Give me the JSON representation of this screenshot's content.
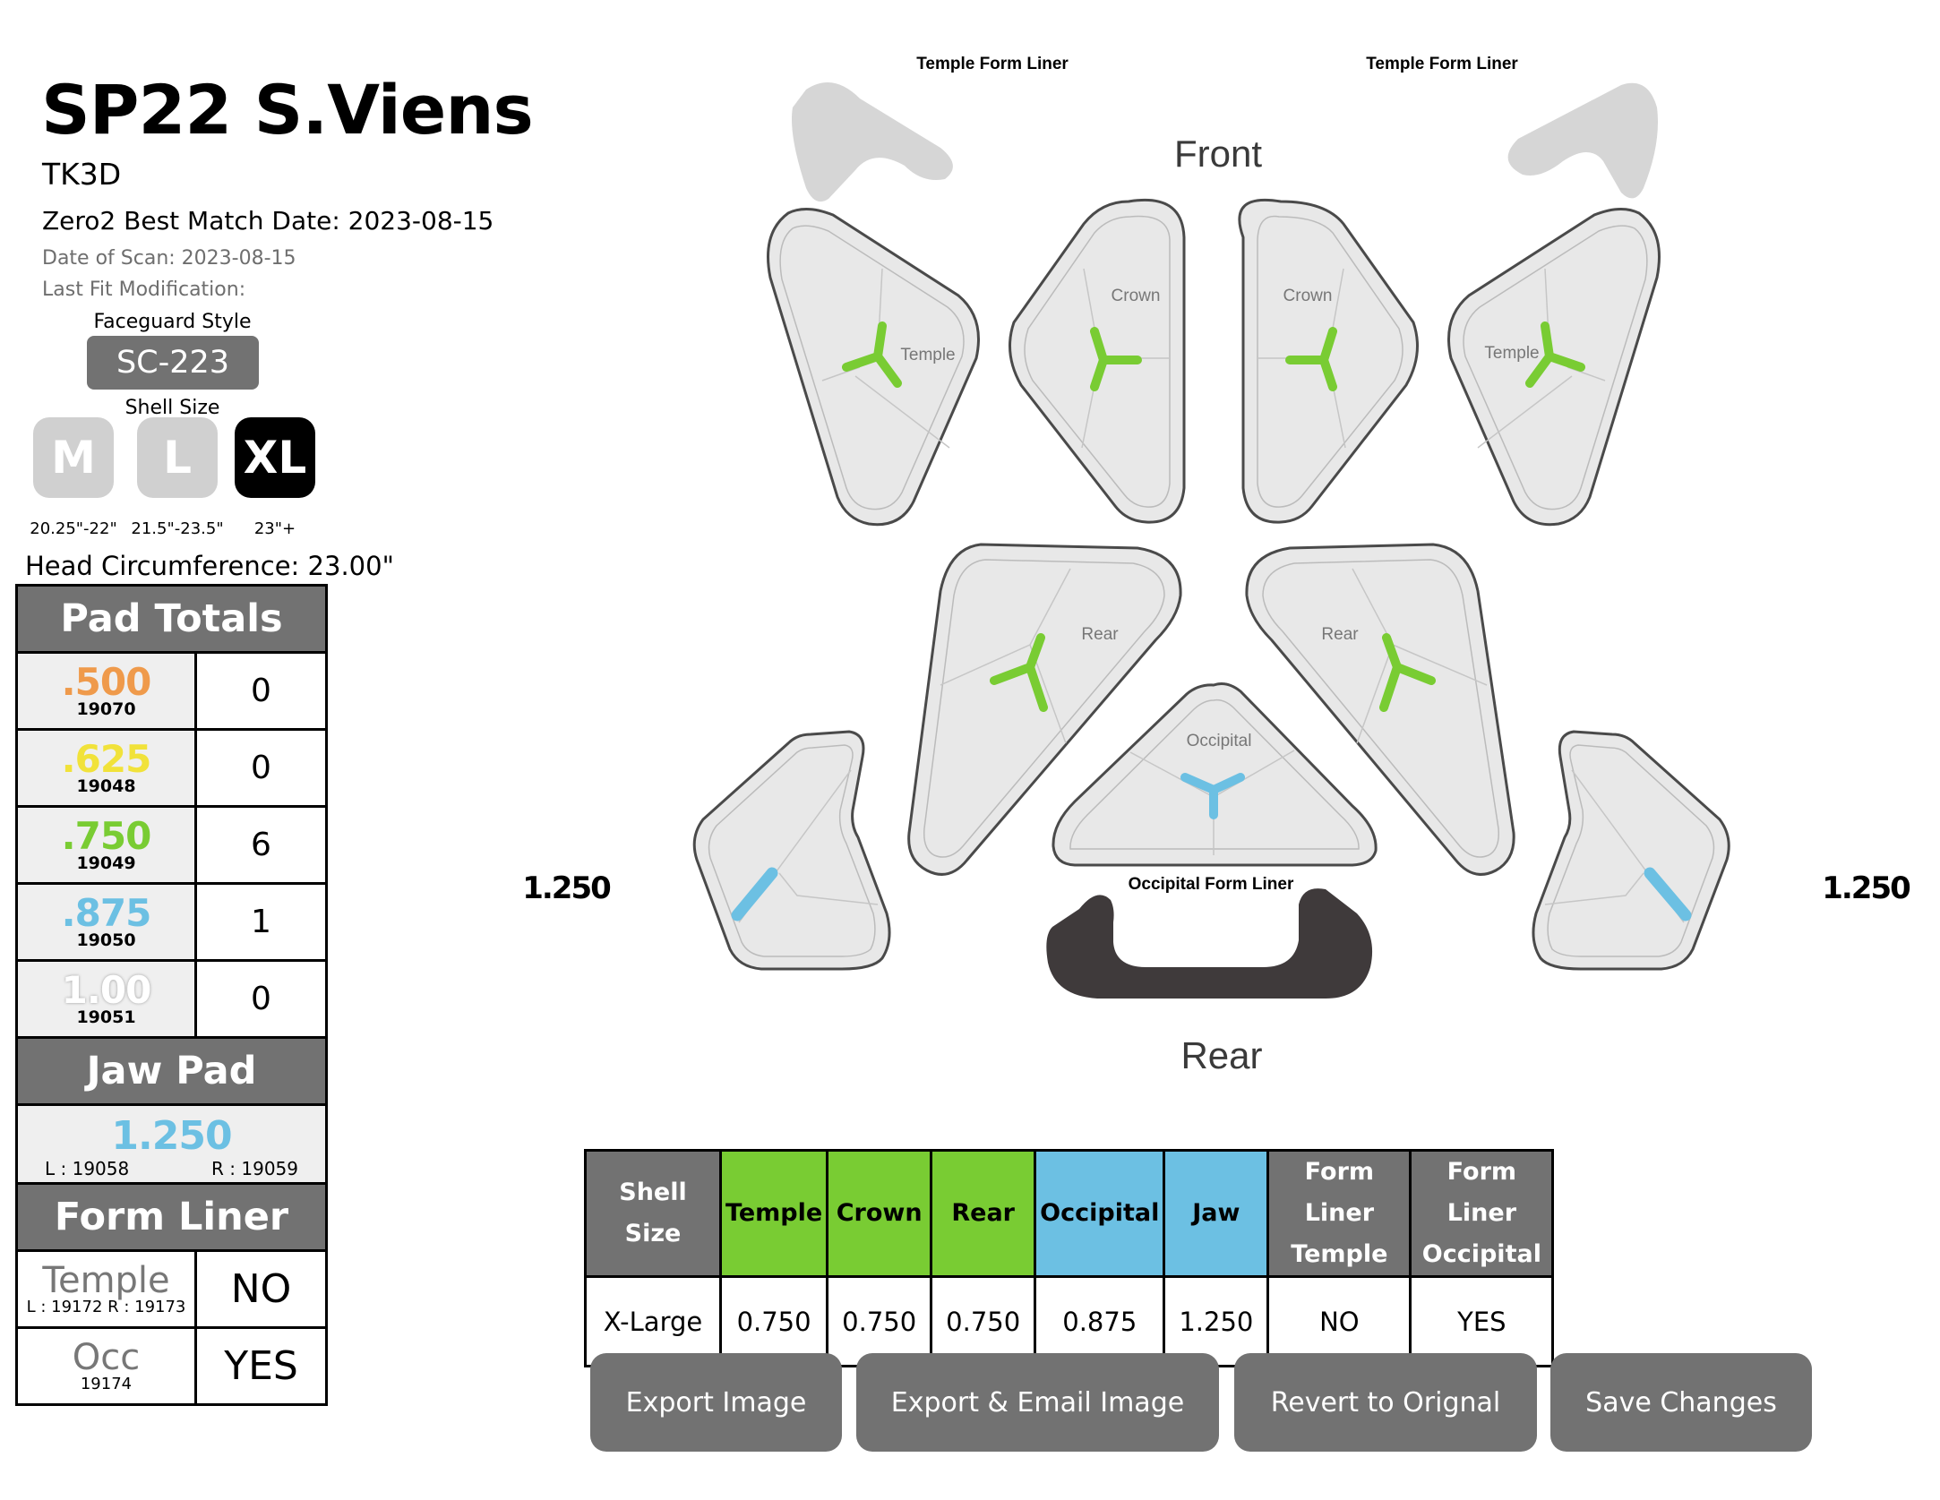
{
  "header": {
    "title": "SP22 S.Viens",
    "subtitle": "TK3D",
    "best_match": "Zero2 Best Match Date: 2023-08-15",
    "date_of_scan": "Date of Scan: 2023-08-15",
    "last_fit_modification": "Last Fit Modification:"
  },
  "faceguard": {
    "label": "Faceguard Style",
    "value": "SC-223"
  },
  "shell": {
    "label": "Shell Size",
    "sizes": [
      {
        "label": "M",
        "range": "20.25\"-22\"",
        "selected": false
      },
      {
        "label": "L",
        "range": "21.5\"-23.5\"",
        "selected": false
      },
      {
        "label": "XL",
        "range": "23\"+",
        "selected": true
      }
    ],
    "head_circumference": "Head Circumference: 23.00\""
  },
  "pad_totals": {
    "title": "Pad Totals",
    "rows": [
      {
        "size": ".500",
        "part": "19070",
        "count": "0",
        "color": "#ef9a4b"
      },
      {
        "size": ".625",
        "part": "19048",
        "count": "0",
        "color": "#f1e23a"
      },
      {
        "size": ".750",
        "part": "19049",
        "count": "6",
        "color": "#79cc33"
      },
      {
        "size": ".875",
        "part": "19050",
        "count": "1",
        "color": "#6cc0e3"
      },
      {
        "size": "1.00",
        "part": "19051",
        "count": "0",
        "color": "#ffffff"
      }
    ]
  },
  "jaw_pad": {
    "title": "Jaw Pad",
    "size": "1.250",
    "left_part": "L : 19058",
    "right_part": "R : 19059",
    "color": "#6cc0e3"
  },
  "form_liner": {
    "title": "Form Liner",
    "rows": [
      {
        "name": "Temple",
        "parts": "L : 19172  R : 19173",
        "value": "NO"
      },
      {
        "name": "Occ",
        "parts": "19174",
        "value": "YES"
      }
    ]
  },
  "diagram": {
    "front_label": "Front",
    "rear_label": "Rear",
    "temple_form_liner_left": "Temple Form Liner",
    "temple_form_liner_right": "Temple Form Liner",
    "occipital_form_liner": "Occipital Form Liner",
    "jaw_left_value": "1.250",
    "jaw_right_value": "1.250",
    "pads": {
      "temple_left": {
        "label": "Temple",
        "color": "#79cc33"
      },
      "crown_left": {
        "label": "Crown",
        "color": "#79cc33"
      },
      "crown_right": {
        "label": "Crown",
        "color": "#79cc33"
      },
      "temple_right": {
        "label": "Temple",
        "color": "#79cc33"
      },
      "rear_left": {
        "label": "Rear",
        "color": "#79cc33"
      },
      "rear_right": {
        "label": "Rear",
        "color": "#79cc33"
      },
      "occipital": {
        "label": "Occipital",
        "color": "#6cc0e3"
      },
      "jaw_left": {
        "color": "#6cc0e3"
      },
      "jaw_right": {
        "color": "#6cc0e3"
      }
    },
    "temple_form_liner_active": false,
    "occipital_form_liner_active": true
  },
  "summary_table": {
    "headers": [
      {
        "label": "Shell Size",
        "style": "gray"
      },
      {
        "label": "Temple",
        "style": "green"
      },
      {
        "label": "Crown",
        "style": "green"
      },
      {
        "label": "Rear",
        "style": "green"
      },
      {
        "label": "Occipital",
        "style": "blue"
      },
      {
        "label": "Jaw",
        "style": "blue"
      },
      {
        "label": "Form Liner Temple",
        "style": "gray"
      },
      {
        "label": "Form Liner Occipital",
        "style": "gray"
      }
    ],
    "values": [
      "X-Large",
      "0.750",
      "0.750",
      "0.750",
      "0.875",
      "1.250",
      "NO",
      "YES"
    ]
  },
  "actions": {
    "export_image": "Export Image",
    "export_email": "Export & Email Image",
    "revert": "Revert to Orignal",
    "save": "Save Changes"
  }
}
